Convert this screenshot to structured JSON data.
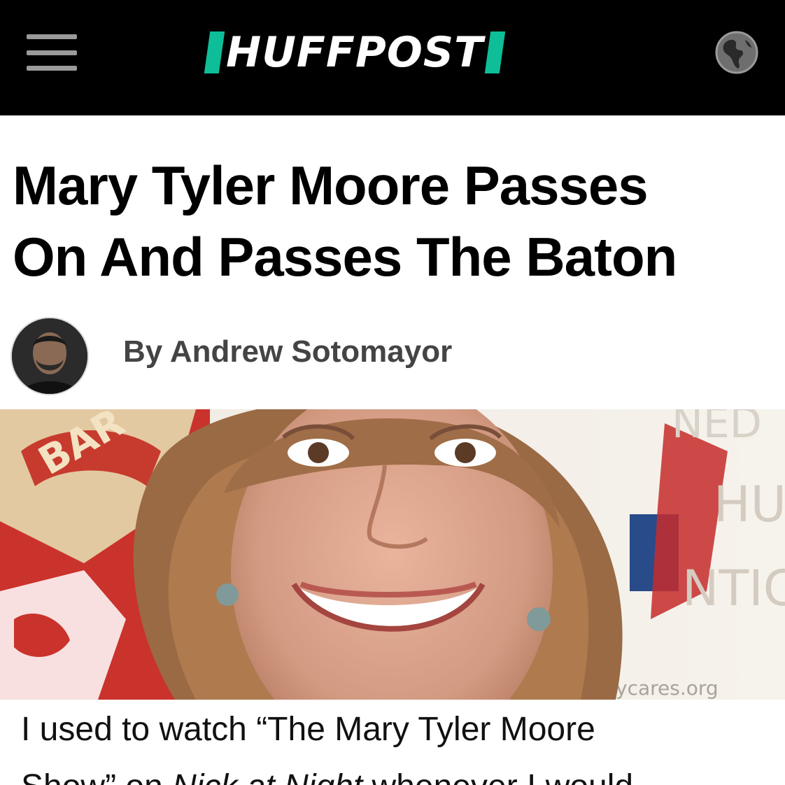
{
  "header": {
    "logo_text": "HUFFPOST",
    "accent_color": "#0dbe98",
    "background_color": "#000000",
    "menu_icon": "hamburger-menu-icon",
    "edition_icon": "globe-icon"
  },
  "article": {
    "headline_line1": "Mary Tyler Moore Passes",
    "headline_line2": "On And Passes The Baton",
    "byline": "By Andrew Sotomayor",
    "body_line1": "I used to watch “The Mary Tyler Moore",
    "body_line2_part1": "Show” on ",
    "body_line2_italic": "Nick at Night",
    "body_line2_part2": " whenever I would"
  },
  "photo": {
    "background_text_top": "BAR",
    "background_text_right": "NED",
    "background_text_hu": "HU",
    "background_text_antic": "NTIC",
    "background_url_text": "ycares.org"
  }
}
